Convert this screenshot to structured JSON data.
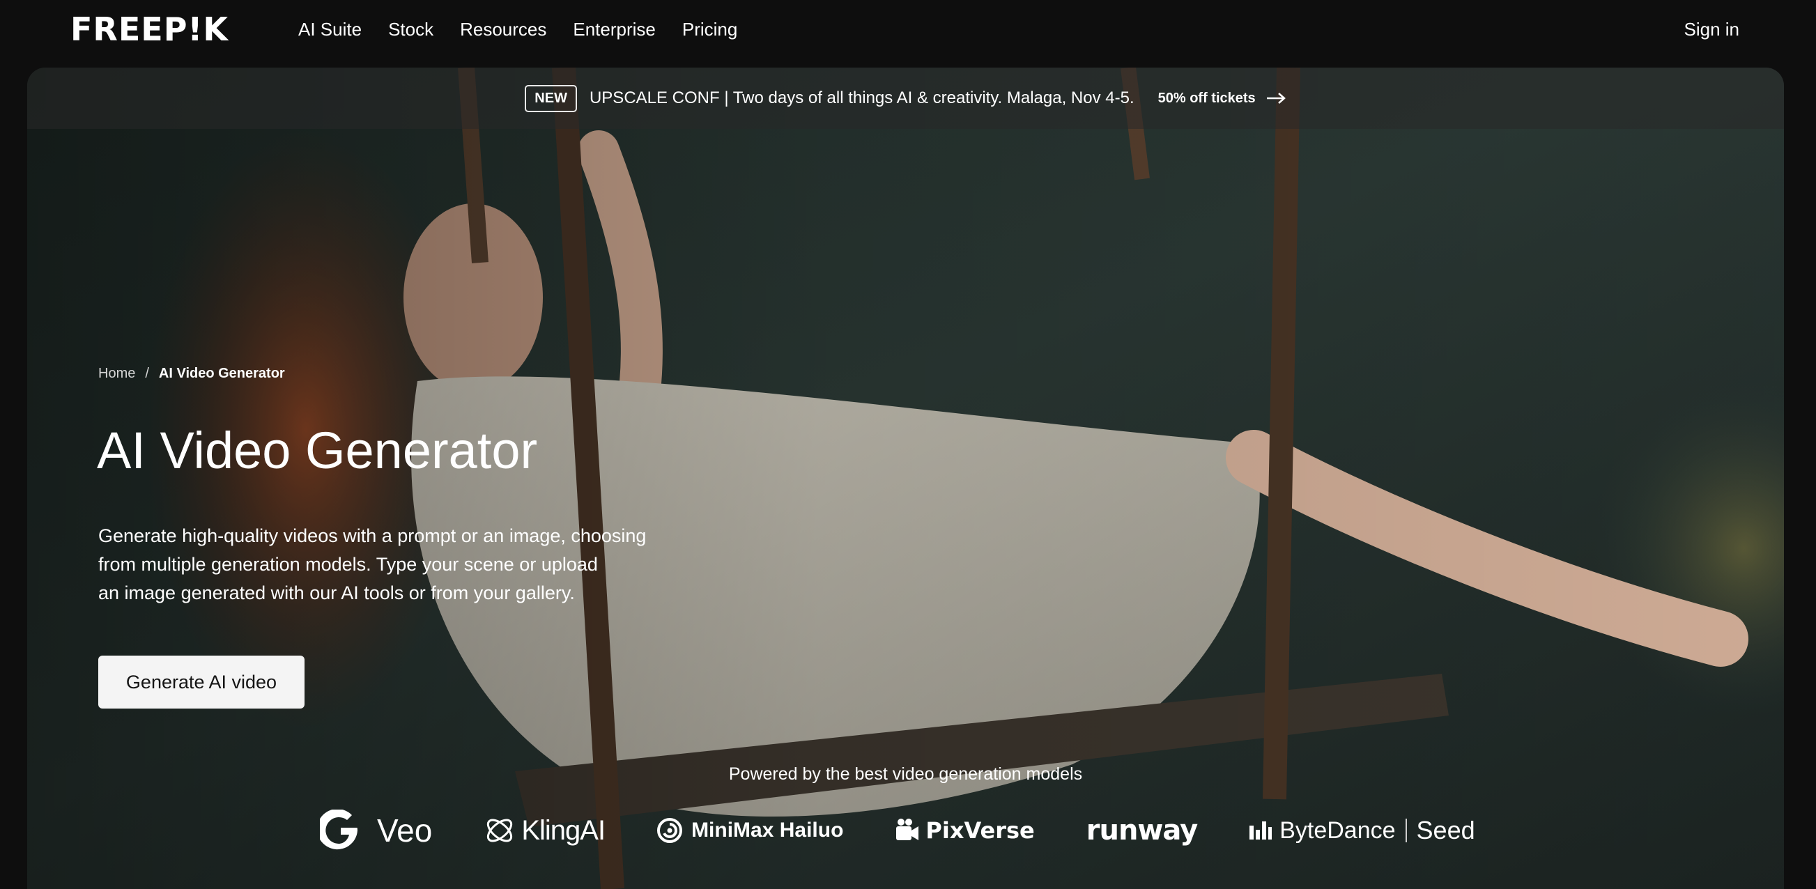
{
  "brand": {
    "logo_text": "FREEP!K"
  },
  "nav": {
    "links": [
      {
        "label": "AI Suite"
      },
      {
        "label": "Stock"
      },
      {
        "label": "Resources"
      },
      {
        "label": "Enterprise"
      },
      {
        "label": "Pricing"
      }
    ],
    "sign_in": "Sign in"
  },
  "announcement": {
    "badge": "NEW",
    "text": "UPSCALE CONF | Two days of all things AI & creativity. Malaga, Nov 4-5.",
    "link": "50% off tickets",
    "link_icon": "arrow-right-icon"
  },
  "breadcrumb": {
    "home": "Home",
    "separator": "/",
    "current": "AI Video Generator"
  },
  "hero": {
    "title": "AI Video Generator",
    "description_lines": [
      "Generate high-quality videos with a prompt or an image, choosing",
      "from multiple generation models. Type your scene or upload",
      "an image generated with our AI tools or from your gallery."
    ],
    "cta": "Generate AI video",
    "background": "woman in white dress on rope swing"
  },
  "powered_by": {
    "heading": "Powered by the best video generation models",
    "models": [
      {
        "label": "Veo",
        "icon": "google-icon"
      },
      {
        "label": "KlingAI",
        "icon": "kling-icon"
      },
      {
        "label": "MiniMax Hailuo",
        "icon": "minimax-icon"
      },
      {
        "label": "PixVerse",
        "icon": "pixverse-icon"
      },
      {
        "label": "runway",
        "icon": ""
      },
      {
        "label": "ByteDance",
        "secondary": "Seed",
        "icon": "bytedance-icon"
      }
    ]
  },
  "colors": {
    "page_bg": "#0e0e0e",
    "cta_bg": "#f4f4f4",
    "cta_text": "#141414",
    "text": "#ffffff"
  }
}
